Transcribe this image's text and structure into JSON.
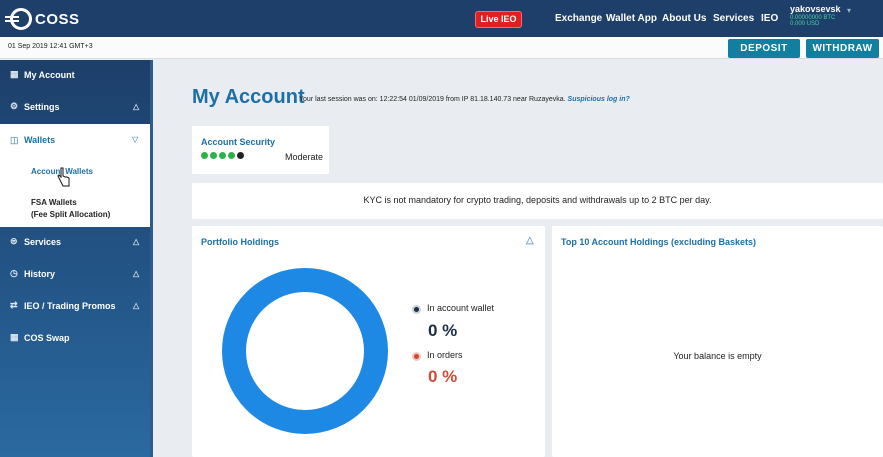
{
  "topbar": {
    "logo_text": "COSS",
    "live_ieo": "Live IEO",
    "nav": [
      "Exchange",
      "Wallet App",
      "About Us",
      "Services",
      "IEO"
    ],
    "username": "yakovsevsk",
    "balance_btc": "0.00000000 BTC",
    "balance_usd": "0.000 USD"
  },
  "subbar": {
    "datetime": "01 Sep 2019 12:41 GMT+3",
    "deposit_label": "DEPOSIT",
    "withdraw_label": "WITHDRAW"
  },
  "sidebar": {
    "items": [
      {
        "label": "My Account",
        "icon": "account-icon"
      },
      {
        "label": "Settings",
        "icon": "gear-icon"
      },
      {
        "label": "Wallets",
        "icon": "wallet-icon"
      },
      {
        "label": "Services",
        "icon": "services-icon"
      },
      {
        "label": "History",
        "icon": "history-icon"
      },
      {
        "label": "IEO / Trading Promos",
        "icon": "promo-icon"
      },
      {
        "label": "COS Swap",
        "icon": "swap-icon"
      }
    ],
    "wallets_sub": {
      "account_wallets": "Account Wallets",
      "fsa_wallets_line1": "FSA Wallets",
      "fsa_wallets_line2": "(Fee Split Allocation)"
    }
  },
  "main": {
    "title": "My Account",
    "session_text": "Your last session was on: 12:22:54 01/09/2019 from IP 81.18.140.73 near Ruzayevka.",
    "suspicious_link": "Suspicious log in?",
    "security": {
      "title": "Account Security",
      "level": "Moderate",
      "filled_dots": 4,
      "total_dots": 5
    },
    "kyc_notice": "KYC is not mandatory for crypto trading, deposits and withdrawals up to 2 BTC per day.",
    "portfolio": {
      "title": "Portfolio Holdings",
      "legend": [
        {
          "label": "In account wallet",
          "value": "0 %",
          "color": "#1d2f44"
        },
        {
          "label": "In orders",
          "value": "0 %",
          "color": "#d24a35"
        }
      ],
      "donut_color": "#1e88e5"
    },
    "top_holdings": {
      "title": "Top 10 Account Holdings (excluding Baskets)",
      "empty_text": "Your balance is empty"
    }
  }
}
